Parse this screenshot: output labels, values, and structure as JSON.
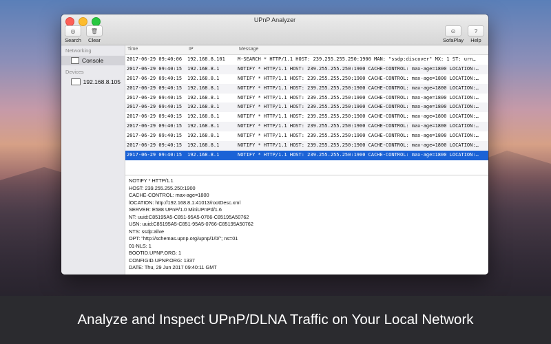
{
  "window": {
    "title": "UPnP Analyzer"
  },
  "toolbar": {
    "search_label": "Search",
    "clear_label": "Clear",
    "sofaplay_label": "SofaPlay",
    "help_label": "Help"
  },
  "sidebar": {
    "networking_header": "Networking",
    "console_label": "Console",
    "devices_header": "Devices",
    "device_label": "192.168.8.105"
  },
  "table": {
    "columns": [
      "Time",
      "IP",
      "Message"
    ],
    "rows": [
      {
        "time": "2017-06-29 09:40:06",
        "ip": "192.168.8.101",
        "message": "M-SEARCH * HTTP/1.1  HOST: 239.255.255.250:1900  MAN: \"ssdp:discover\"  MX: 1  ST: urn…"
      },
      {
        "time": "2017-06-29 09:40:15",
        "ip": "192.168.8.1",
        "message": "NOTIFY * HTTP/1.1  HOST: 239.255.255.250:1900  CACHE-CONTROL: max-age=1800  LOCATION:…"
      },
      {
        "time": "2017-06-29 09:40:15",
        "ip": "192.168.8.1",
        "message": "NOTIFY * HTTP/1.1  HOST: 239.255.255.250:1900  CACHE-CONTROL: max-age=1800  LOCATION:…"
      },
      {
        "time": "2017-06-29 09:40:15",
        "ip": "192.168.8.1",
        "message": "NOTIFY * HTTP/1.1  HOST: 239.255.255.250:1900  CACHE-CONTROL: max-age=1800  LOCATION:…"
      },
      {
        "time": "2017-06-29 09:40:15",
        "ip": "192.168.8.1",
        "message": "NOTIFY * HTTP/1.1  HOST: 239.255.255.250:1900  CACHE-CONTROL: max-age=1800  LOCATION:…"
      },
      {
        "time": "2017-06-29 09:40:15",
        "ip": "192.168.8.1",
        "message": "NOTIFY * HTTP/1.1  HOST: 239.255.255.250:1900  CACHE-CONTROL: max-age=1800  LOCATION:…"
      },
      {
        "time": "2017-06-29 09:40:15",
        "ip": "192.168.8.1",
        "message": "NOTIFY * HTTP/1.1  HOST: 239.255.255.250:1900  CACHE-CONTROL: max-age=1800  LOCATION:…"
      },
      {
        "time": "2017-06-29 09:40:15",
        "ip": "192.168.8.1",
        "message": "NOTIFY * HTTP/1.1  HOST: 239.255.255.250:1900  CACHE-CONTROL: max-age=1800  LOCATION:…"
      },
      {
        "time": "2017-06-29 09:40:15",
        "ip": "192.168.8.1",
        "message": "NOTIFY * HTTP/1.1  HOST: 239.255.255.250:1900  CACHE-CONTROL: max-age=1800  LOCATION:…"
      },
      {
        "time": "2017-06-29 09:40:15",
        "ip": "192.168.8.1",
        "message": "NOTIFY * HTTP/1.1  HOST: 239.255.255.250:1900  CACHE-CONTROL: max-age=1800  LOCATION:…"
      },
      {
        "time": "2017-06-29 09:40:15",
        "ip": "192.168.8.1",
        "message": "NOTIFY * HTTP/1.1  HOST: 239.255.255.250:1900  CACHE-CONTROL: max-age=1800  LOCATION:…"
      }
    ],
    "selected_index": 10
  },
  "detail": {
    "lines": [
      "NOTIFY * HTTP/1.1",
      "HOST: 239.255.255.250:1900",
      "CACHE-CONTROL: max-age=1800",
      "lOCATION: http://192.168.8.1:41013/rootDesc.xml",
      "SERVER: E588 UPnP/1.0 MiniUPnPd/1.6",
      "NT: uuid:C85195A5-C851-95A5-0766-C85195A50762",
      "USN: uuid:C85195A5-C851-95A5-0766-C85195A50762",
      "NTS: ssdp:alive",
      "OPT: \"http://schemas.upnp.org/upnp/1/0/\"; ns=01",
      "01-NLS: 1",
      "BOOTID.UPNP.ORG: 1",
      "CONFIGID.UPNP.ORG: 1337",
      "DATE: Thu, 29 Jun 2017 09:40:11 GMT"
    ]
  },
  "caption": "Analyze and Inspect UPnP/DLNA Traffic on Your Local Network",
  "colors": {
    "selection": "#1a62d6",
    "caption_bg": "#2b2b2f"
  }
}
